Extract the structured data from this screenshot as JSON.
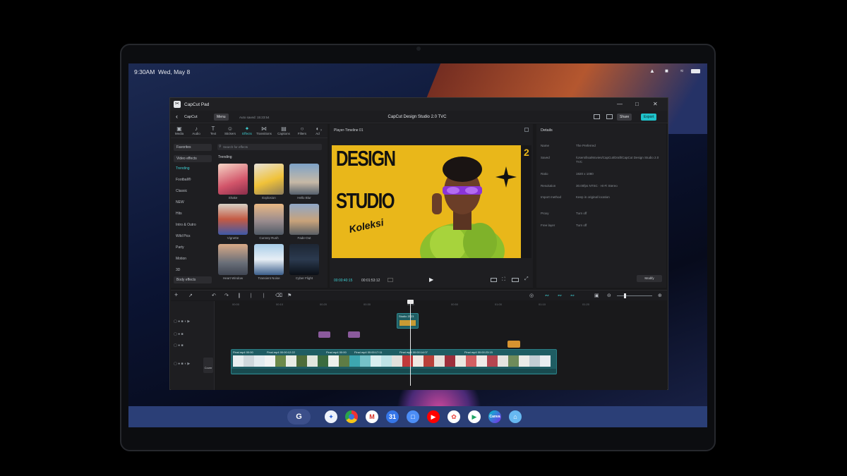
{
  "status": {
    "time": "9:30AM",
    "date": "Wed, May 8"
  },
  "app": {
    "name": "CapCut Pad",
    "capcut_label": "CapCut",
    "menu_label": "Menu",
    "autosave": "Auto saved: 15:23:54",
    "project_title": "CapCut Design Studio 2.0 TVC",
    "share_label": "Share",
    "export_label": "Export"
  },
  "tools": [
    "Media",
    "Audio",
    "Text",
    "Stickers",
    "Effects",
    "Transitions",
    "Captions",
    "Filters",
    "Ad"
  ],
  "categories": {
    "favorites": "Favorites",
    "video_effects": "Video effects",
    "items": [
      "Trending",
      "Football®",
      "Classic",
      "NEW",
      "Hits",
      "Intro & Outro",
      "Wild Pics",
      "Party",
      "Motion",
      "3D"
    ],
    "body_effects": "Body effects"
  },
  "search_placeholder": "Search for effects",
  "trending_label": "Trending",
  "effects": [
    {
      "name": "Shake"
    },
    {
      "name": "Explosion"
    },
    {
      "name": "Hello Blur"
    },
    {
      "name": "Vignette"
    },
    {
      "name": "Cunney Rush"
    },
    {
      "name": "Fade-Out"
    },
    {
      "name": "Heart Window"
    },
    {
      "name": "Transient Noise"
    },
    {
      "name": "Cyber Flight"
    }
  ],
  "player": {
    "title": "Player-Timeline 01",
    "headline1": "DESIGN",
    "headline2": "STUDIO",
    "signature": "Koleksi",
    "corner_num": "2",
    "timecode_current": "00:00:40:15",
    "timecode_total": "00:01:53:12"
  },
  "details": {
    "title": "Details",
    "rows": [
      {
        "key": "Name",
        "value": "The Preferred"
      },
      {
        "key": "Saved",
        "value": "/Users/lisa/Movies/CapCut/Draft/CapCut Design Studio 2.0 TVC"
      },
      {
        "key": "Ratio",
        "value": "1920 x 1080"
      },
      {
        "key": "Resolution",
        "value": "30.00fps NTSC · Hi-Fi Stereo"
      },
      {
        "key": "Import method",
        "value": "Keep in original location"
      },
      {
        "key": "Proxy",
        "value": "Turn off"
      },
      {
        "key": "Free layer",
        "value": "Turn off"
      }
    ],
    "modify_label": "Modify"
  },
  "timeline": {
    "ruler": [
      "00:00",
      "00:10",
      "00:20",
      "00:30",
      "00:40",
      "00:50",
      "01:00",
      "01:10",
      "01:20"
    ],
    "cover_label": "Cover",
    "clips": [
      "Final.mp4",
      "Final.mp4",
      "Final.mp4",
      "Final.mp4",
      "Final.mp4",
      "Final.mp4"
    ],
    "clip_times": [
      "00:00",
      "00:00:12:22",
      "00:00",
      "00:00:17:11",
      "00:00:14:07",
      "00:00:23:15"
    ],
    "text_clip": "Studio 2023"
  },
  "colors": {
    "accent": "#3fd0d4",
    "canvas_yellow": "#e9b71a",
    "video_clip": "#1f5d63",
    "audio_clip": "#8a5a9c",
    "sticker_clip": "#d79330"
  }
}
